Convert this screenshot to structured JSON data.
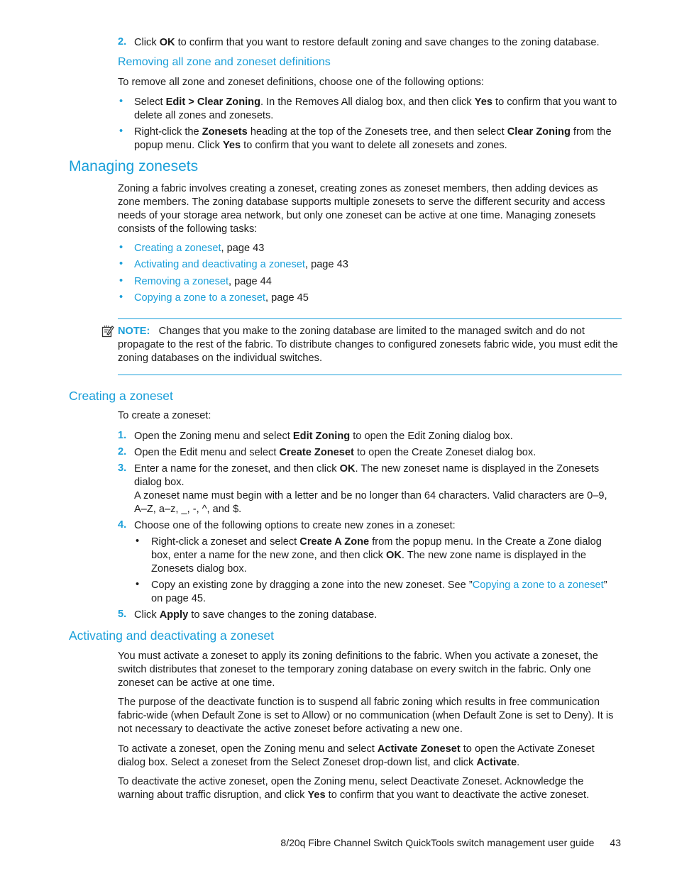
{
  "top_step": {
    "num": "2.",
    "pre": "Click ",
    "b1": "OK",
    "post": " to confirm that you want to restore default zoning and save changes to the zoning database."
  },
  "removing_all": {
    "heading": "Removing all zone and zoneset definitions",
    "intro": "To remove all zone and zoneset definitions, choose one of the following options:",
    "b1": {
      "pre": "Select ",
      "bold1": "Edit > Clear Zoning",
      "mid": ". In the Removes All dialog box, and then click ",
      "bold2": "Yes",
      "post": " to confirm that you want to delete all zones and zonesets."
    },
    "b2": {
      "pre": "Right-click the ",
      "bold1": "Zonesets",
      "mid": " heading at the top of the Zonesets tree, and then select ",
      "bold2": "Clear Zoning",
      "mid2": " from the popup menu. Click ",
      "bold3": "Yes",
      "post": " to confirm that you want to delete all zonesets and zones."
    }
  },
  "managing": {
    "heading": "Managing zonesets",
    "intro": "Zoning a fabric involves creating a zoneset, creating zones as zoneset members, then adding devices as zone members. The zoning database supports multiple zonesets to serve the different security and access needs of your storage area network, but only one zoneset can be active at one time. Managing zonesets consists of the following tasks:",
    "tasks": [
      {
        "link": "Creating a zoneset",
        "page": ", page 43"
      },
      {
        "link": "Activating and deactivating a zoneset",
        "page": ", page 43"
      },
      {
        "link": "Removing a zoneset",
        "page": ", page 44"
      },
      {
        "link": "Copying a zone to a zoneset",
        "page": ", page 45"
      }
    ],
    "note_label": "NOTE:",
    "note_text": "Changes that you make to the zoning database are limited to the managed switch and do not propagate to the rest of the fabric. To distribute changes to configured zonesets fabric wide, you must edit the zoning databases on the individual switches."
  },
  "creating": {
    "heading": "Creating a zoneset",
    "intro": "To create a zoneset:",
    "steps": [
      {
        "num": "1.",
        "pre": "Open the Zoning menu and select ",
        "bold": "Edit Zoning",
        "post": " to open the Edit Zoning dialog box."
      },
      {
        "num": "2.",
        "pre": "Open the Edit menu and select ",
        "bold": "Create Zoneset",
        "post": " to open the Create Zoneset dialog box."
      },
      {
        "num": "3.",
        "pre": "Enter a name for the zoneset, and then click ",
        "bold": "OK",
        "post": ". The new zoneset name is displayed in the Zonesets dialog box.",
        "extra": "A zoneset name must begin with a letter and be no longer than 64 characters. Valid characters are 0–9, A–Z, a–z, _, -, ^, and $."
      },
      {
        "num": "4.",
        "text": "Choose one of the following options to create new zones in a zoneset:"
      },
      {
        "num": "5.",
        "pre": "Click ",
        "bold": "Apply",
        "post": " to save changes to the zoning database."
      }
    ],
    "sub1": {
      "pre": "Right-click a zoneset and select ",
      "bold1": "Create A Zone",
      "mid": " from the popup menu. In the Create a Zone dialog box, enter a name for the new zone, and then click ",
      "bold2": "OK",
      "post": ". The new zone name is displayed in the Zonesets dialog box."
    },
    "sub2": {
      "pre": "Copy an existing zone by dragging a zone into the new zoneset. See ”",
      "link": "Copying a zone to a zoneset",
      "post": "” on page 45."
    }
  },
  "activating": {
    "heading": "Activating and deactivating a zoneset",
    "p1": "You must activate a zoneset to apply its zoning definitions to the fabric. When you activate a zoneset, the switch distributes that zoneset to the temporary zoning database on every switch in the fabric. Only one zoneset can be active at one time.",
    "p2": "The purpose of the deactivate function is to suspend all fabric zoning which results in free communication fabric-wide (when Default Zone is set to Allow) or no communication (when Default Zone is set to Deny). It is not necessary to deactivate the active zoneset before activating a new one.",
    "p3": {
      "pre": "To activate a zoneset, open the Zoning menu and select ",
      "bold1": "Activate Zoneset",
      "mid": " to open the Activate Zoneset dialog box. Select a zoneset from the Select Zoneset drop-down list, and click ",
      "bold2": "Activate",
      "post": "."
    },
    "p4": {
      "pre": "To deactivate the active zoneset, open the Zoning menu, select Deactivate Zoneset. Acknowledge the warning about traffic disruption, and click ",
      "bold": "Yes",
      "post": " to confirm that you want to deactivate the active zoneset."
    }
  },
  "footer": {
    "title": "8/20q Fibre Channel Switch QuickTools switch management user guide",
    "page": "43"
  }
}
